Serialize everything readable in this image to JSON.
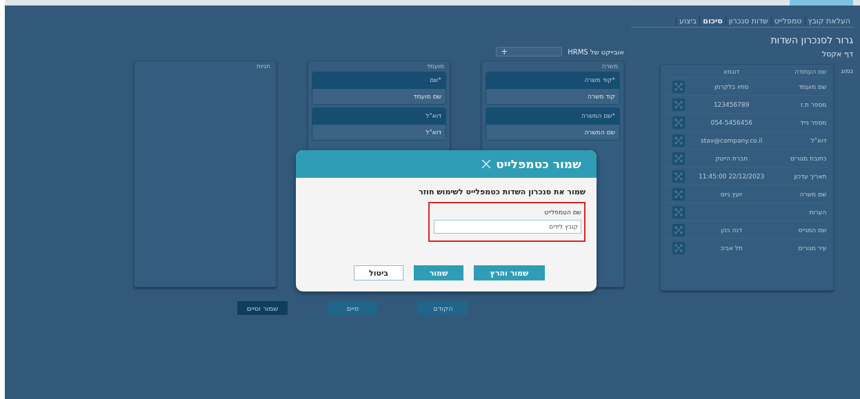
{
  "tabs": [
    {
      "label": "העלאת קובץ",
      "selected": false
    },
    {
      "label": "טמפלייט",
      "selected": false
    },
    {
      "label": "שדות סנכרון",
      "selected": false
    },
    {
      "label": "סיכום",
      "selected": true
    },
    {
      "label": "ביצוע",
      "selected": false
    }
  ],
  "title": "גרור לסנכרון השדות",
  "subtitle": "דף אקסל",
  "side_label": "נמוג",
  "excel_table": {
    "columns": [
      "שם העמודה",
      "דוגמא"
    ],
    "rows": [
      {
        "column": "שם מועמד",
        "example": "סתיו בלקרמן"
      },
      {
        "column": "מספר ת.ז",
        "example": "123456789"
      },
      {
        "column": "מספר נייד",
        "example": "054-5456456"
      },
      {
        "column": "דוא\"ל",
        "example": "stav@company.co.il"
      },
      {
        "column": "כתובת מגורים",
        "example": "חברת הייטק"
      },
      {
        "column": "תאריך עדכון",
        "example": "22/12/2023 11:45:00"
      },
      {
        "column": "שם משרה",
        "example": "יועץ גיוס"
      },
      {
        "column": "הערות",
        "example": ""
      },
      {
        "column": "שם המגייס",
        "example": "דנה כהן"
      },
      {
        "column": "עיר מגורים",
        "example": "תל אביב"
      }
    ]
  },
  "object_label": "אובייקט של HRMS",
  "object_select": {
    "value": "+"
  },
  "columns": [
    {
      "title": "משרה",
      "cards": [
        {
          "field": "*קוד משרה",
          "mapped": "קוד משרה"
        },
        {
          "field": "*שם המשרה",
          "mapped": "שם המשרה"
        }
      ]
    },
    {
      "title": "מועמד",
      "cards": [
        {
          "field": "*שם",
          "mapped": "שם מועמד"
        },
        {
          "field": "דוא\"ל",
          "mapped": "דוא\"ל"
        }
      ]
    },
    {
      "title": "תגיות"
    }
  ],
  "footer_buttons": [
    {
      "label": "הקודם",
      "kind": "secondary"
    },
    {
      "label": "סיים",
      "kind": "secondary"
    },
    {
      "label": "שמור וסיים",
      "kind": "primary"
    }
  ],
  "dialog": {
    "title": "שמור כטמפלייט",
    "message": "שמור את סנכרון השדות כטמפלייט לשימוש חוזר",
    "field_label": "שם הטמפלייט",
    "field_value": "קובץ לידים",
    "highlighted": true,
    "buttons": [
      {
        "label": "שמור והרץ",
        "kind": "primary"
      },
      {
        "label": "שמור",
        "kind": "primary"
      },
      {
        "label": "ביטול",
        "kind": "outline"
      }
    ]
  }
}
